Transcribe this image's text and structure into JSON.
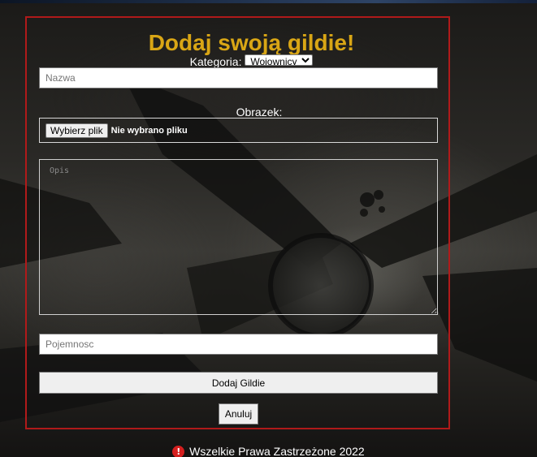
{
  "page": {
    "title": "Dodaj swoją gildie!"
  },
  "category": {
    "label": "Kategoria:",
    "selected": "Wojownicy",
    "options": [
      "Wojownicy"
    ]
  },
  "form": {
    "name_placeholder": "Nazwa",
    "image_label": "Obrazek:",
    "file_button_label": "Wybierz plik",
    "file_status": "Nie wybrano pliku",
    "description_placeholder": "Opis",
    "capacity_placeholder": "Pojemnosc",
    "submit_label": "Dodaj Gildie",
    "cancel_label": "Anuluj"
  },
  "footer": {
    "icon": "exclamation-circle-icon",
    "text": "Wszelkie Prawa Zastrzeżone 2022"
  },
  "colors": {
    "title": "#d9a615",
    "frame_border": "#b01a1a",
    "footer_icon": "#d51f1f"
  }
}
